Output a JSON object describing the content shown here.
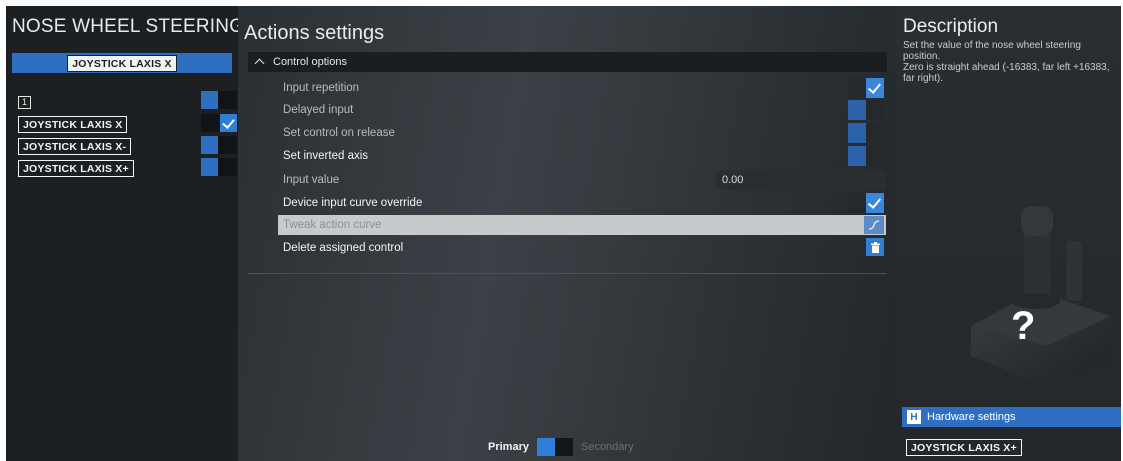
{
  "left": {
    "title": "NOSE WHEEL STEERING A",
    "header_key": "JOYSTICK LAXIS X",
    "slot_number": "1",
    "bindings": [
      {
        "label": "JOYSTICK LAXIS X",
        "state": "on"
      },
      {
        "label": "JOYSTICK LAXIS X-",
        "state": "off"
      },
      {
        "label": "JOYSTICK LAXIS X+",
        "state": "off"
      }
    ]
  },
  "middle": {
    "title": "Actions settings",
    "section": "Control options",
    "options": [
      {
        "label": "Input repetition",
        "state": "on"
      },
      {
        "label": "Delayed input",
        "state": "off"
      },
      {
        "label": "Set control on release",
        "state": "off"
      },
      {
        "label": "Set inverted axis",
        "state": "off"
      },
      {
        "label": "Input value",
        "value": "0.00"
      },
      {
        "label": "Device input curve override",
        "state": "on"
      },
      {
        "label": "Tweak action curve"
      },
      {
        "label": "Delete assigned control"
      }
    ],
    "footer": {
      "primary": "Primary",
      "secondary": "Secondary"
    }
  },
  "right": {
    "title": "Description",
    "lines": [
      "Set the value of the nose wheel steering position.",
      "Zero is straight ahead (-16383, far left +16383, far right)."
    ],
    "help_symbol": "?",
    "hardware_key": "H",
    "hardware_label": "Hardware settings",
    "device_key": "JOYSTICK LAXIS X+"
  },
  "colors": {
    "accent": "#2f6fc1",
    "accent_bright": "#2f7fd6"
  }
}
